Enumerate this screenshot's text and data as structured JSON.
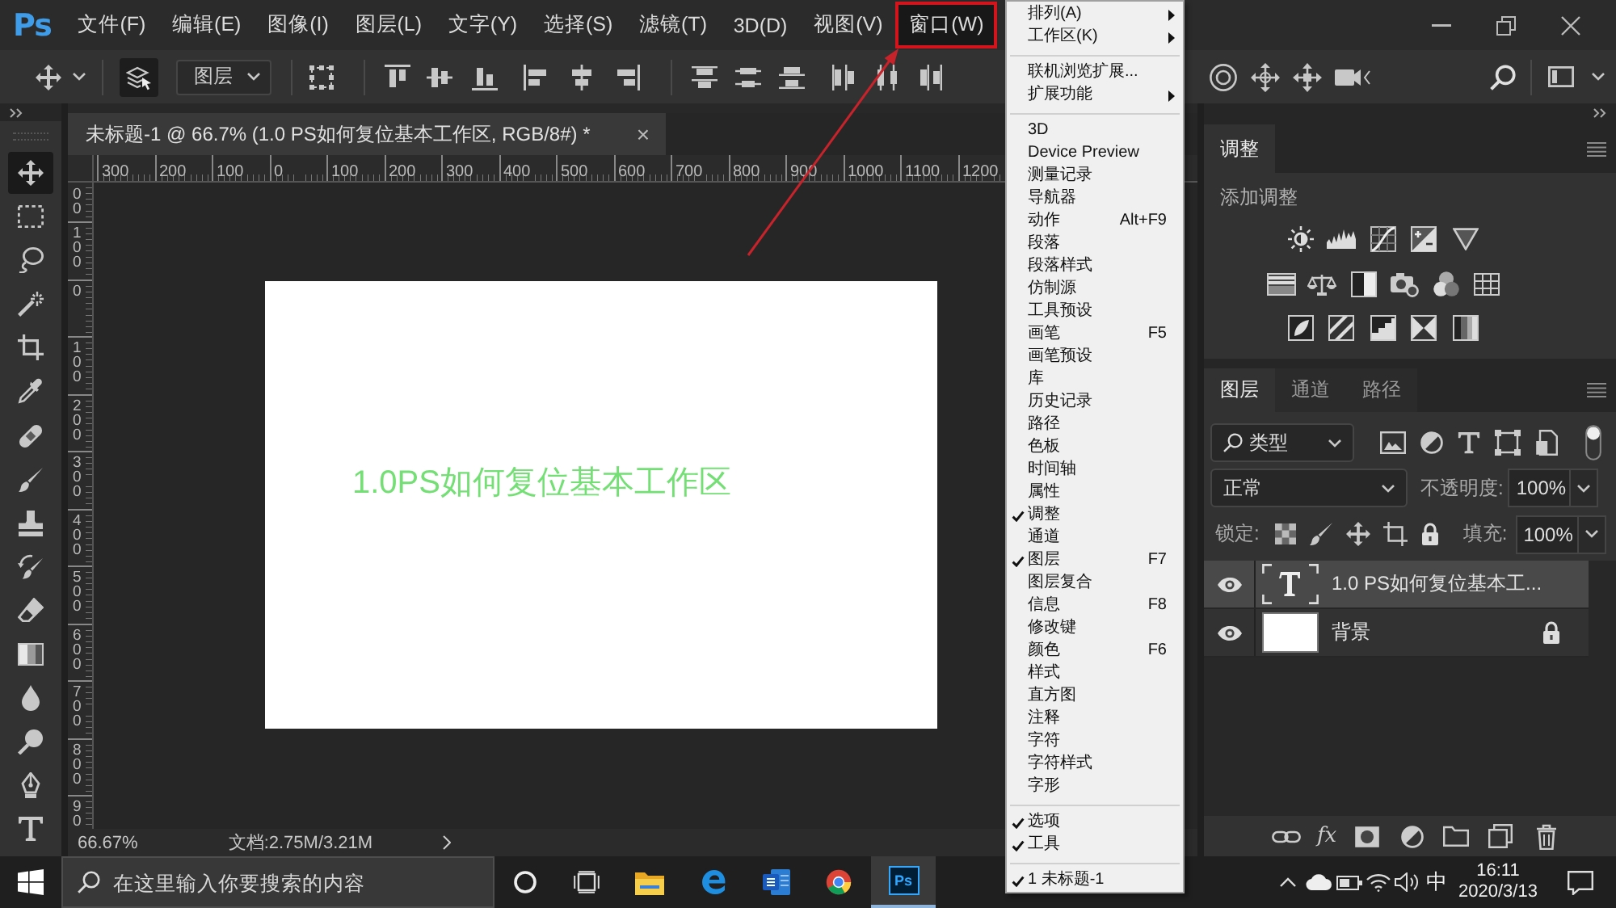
{
  "menubar": {
    "logo": "Ps",
    "items": [
      {
        "label": "文件(F)",
        "selected": false,
        "highlighted": false
      },
      {
        "label": "编辑(E)",
        "selected": false,
        "highlighted": false
      },
      {
        "label": "图像(I)",
        "selected": false,
        "highlighted": false
      },
      {
        "label": "图层(L)",
        "selected": false,
        "highlighted": false
      },
      {
        "label": "文字(Y)",
        "selected": false,
        "highlighted": false
      },
      {
        "label": "选择(S)",
        "selected": false,
        "highlighted": false
      },
      {
        "label": "滤镜(T)",
        "selected": false,
        "highlighted": false
      },
      {
        "label": "3D(D)",
        "selected": false,
        "highlighted": false
      },
      {
        "label": "视图(V)",
        "selected": false,
        "highlighted": false
      },
      {
        "label": "窗口(W)",
        "selected": true,
        "highlighted": true
      }
    ]
  },
  "options_bar": {
    "layer_select": "图层"
  },
  "tools": [
    {
      "kind": "move",
      "selected": true
    },
    {
      "kind": "marquee",
      "selected": false
    },
    {
      "kind": "lasso",
      "selected": false
    },
    {
      "kind": "magic_wand",
      "selected": false
    },
    {
      "kind": "crop",
      "selected": false
    },
    {
      "kind": "eyedropper",
      "selected": false
    },
    {
      "kind": "healing",
      "selected": false
    },
    {
      "kind": "brush",
      "selected": false
    },
    {
      "kind": "stamp",
      "selected": false
    },
    {
      "kind": "history_brush",
      "selected": false
    },
    {
      "kind": "eraser",
      "selected": false
    },
    {
      "kind": "gradient",
      "selected": false
    },
    {
      "kind": "blur",
      "selected": false
    },
    {
      "kind": "dodge",
      "selected": false
    },
    {
      "kind": "pen",
      "selected": false
    },
    {
      "kind": "type",
      "selected": false
    }
  ],
  "document": {
    "tab_title": "未标题-1 @ 66.7% (1.0 PS如何复位基本工作区, RGB/8#) *",
    "close": "×",
    "h_ruler": [
      "300",
      "200",
      "100",
      "0",
      "100",
      "200",
      "300",
      "400",
      "500",
      "600",
      "700",
      "800",
      "900",
      "1000",
      "1100",
      "1200"
    ],
    "v_ruler": [
      "00",
      "100",
      "0",
      "100",
      "200",
      "300",
      "400",
      "500",
      "600",
      "700",
      "800",
      "90"
    ],
    "canvas_text": "1.0PS如何复位基本工作区",
    "zoom": "66.67%",
    "info": "文档:2.75M/3.21M"
  },
  "adjustments_panel": {
    "tab": "调整",
    "heading": "添加调整"
  },
  "layers_panel": {
    "tabs": [
      {
        "label": "图层",
        "selected": true
      },
      {
        "label": "通道",
        "selected": false
      },
      {
        "label": "路径",
        "selected": false
      }
    ],
    "filter": "类型",
    "blend_mode": "正常",
    "opacity_label": "不透明度:",
    "opacity": "100%",
    "lock_label": "锁定:",
    "fill_label": "填充:",
    "fill": "100%",
    "layers": [
      {
        "name": "1.0 PS如何复位基本工...",
        "kind": "text",
        "visible": true,
        "selected": true,
        "locked": false
      },
      {
        "name": "背景",
        "kind": "image",
        "visible": true,
        "selected": false,
        "locked": true
      }
    ],
    "effects_button": "fx"
  },
  "window_menu": {
    "groups": [
      {
        "items": [
          {
            "label": "排列(A)",
            "checked": false,
            "submenu": true
          },
          {
            "label": "工作区(K)",
            "checked": false,
            "submenu": true
          }
        ]
      },
      {
        "items": [
          {
            "label": "联机浏览扩展...",
            "checked": false,
            "submenu": false
          },
          {
            "label": "扩展功能",
            "checked": false,
            "submenu": true
          }
        ]
      },
      {
        "items": [
          {
            "label": "3D",
            "checked": false,
            "submenu": false
          },
          {
            "label": "Device Preview",
            "checked": false,
            "submenu": false
          },
          {
            "label": "测量记录",
            "checked": false,
            "submenu": false
          },
          {
            "label": "导航器",
            "checked": false,
            "submenu": false
          },
          {
            "label": "动作",
            "shortcut": "Alt+F9",
            "checked": false,
            "submenu": false
          },
          {
            "label": "段落",
            "checked": false,
            "submenu": false
          },
          {
            "label": "段落样式",
            "checked": false,
            "submenu": false
          },
          {
            "label": "仿制源",
            "checked": false,
            "submenu": false
          },
          {
            "label": "工具预设",
            "checked": false,
            "submenu": false
          },
          {
            "label": "画笔",
            "shortcut": "F5",
            "checked": false,
            "submenu": false
          },
          {
            "label": "画笔预设",
            "checked": false,
            "submenu": false
          },
          {
            "label": "库",
            "checked": false,
            "submenu": false
          },
          {
            "label": "历史记录",
            "checked": false,
            "submenu": false
          },
          {
            "label": "路径",
            "checked": false,
            "submenu": false
          },
          {
            "label": "色板",
            "checked": false,
            "submenu": false
          },
          {
            "label": "时间轴",
            "checked": false,
            "submenu": false
          },
          {
            "label": "属性",
            "checked": false,
            "submenu": false
          },
          {
            "label": "调整",
            "checked": true,
            "submenu": false
          },
          {
            "label": "通道",
            "checked": false,
            "submenu": false
          },
          {
            "label": "图层",
            "shortcut": "F7",
            "checked": true,
            "submenu": false
          },
          {
            "label": "图层复合",
            "checked": false,
            "submenu": false
          },
          {
            "label": "信息",
            "shortcut": "F8",
            "checked": false,
            "submenu": false
          },
          {
            "label": "修改键",
            "checked": false,
            "submenu": false
          },
          {
            "label": "颜色",
            "shortcut": "F6",
            "checked": false,
            "submenu": false
          },
          {
            "label": "样式",
            "checked": false,
            "submenu": false
          },
          {
            "label": "直方图",
            "checked": false,
            "submenu": false
          },
          {
            "label": "注释",
            "checked": false,
            "submenu": false
          },
          {
            "label": "字符",
            "checked": false,
            "submenu": false
          },
          {
            "label": "字符样式",
            "checked": false,
            "submenu": false
          },
          {
            "label": "字形",
            "checked": false,
            "submenu": false
          }
        ]
      },
      {
        "items": [
          {
            "label": "选项",
            "checked": true,
            "submenu": false
          },
          {
            "label": "工具",
            "checked": true,
            "submenu": false
          }
        ]
      },
      {
        "items": [
          {
            "label": "1 未标题-1",
            "checked": true,
            "submenu": false
          }
        ]
      }
    ]
  },
  "taskbar": {
    "search_placeholder": "在这里输入你要搜索的内容",
    "apps": [
      {
        "kind": "cortana",
        "active": false
      },
      {
        "kind": "task_view",
        "active": false
      },
      {
        "kind": "explorer",
        "active": false
      },
      {
        "kind": "edge",
        "active": false
      },
      {
        "kind": "word",
        "active": false
      },
      {
        "kind": "chrome",
        "active": false
      },
      {
        "kind": "photoshop",
        "label": "Ps",
        "active": true
      }
    ],
    "ime": "中",
    "time": "16:11",
    "date": "2020/3/13"
  }
}
